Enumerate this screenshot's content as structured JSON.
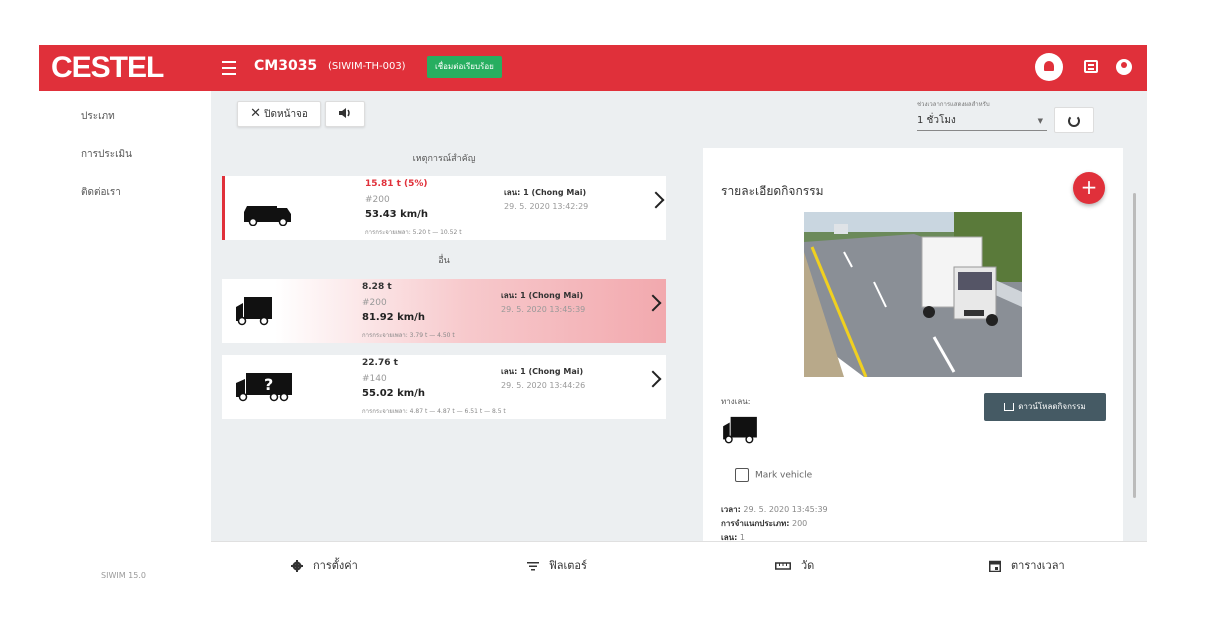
{
  "header": {
    "logo": "CESTEL",
    "device_name": "CM3035",
    "device_id": "(SIWIM-TH-003)",
    "connection_status": "เชื่อมต่อเรียบร้อย",
    "brand_color": "#e0303a",
    "status_color": "#27ae60",
    "icons": [
      "menu-icon",
      "notification-bell-icon",
      "chat-icon",
      "account-icon"
    ]
  },
  "sidebar": {
    "items": [
      {
        "label": "ประเภท"
      },
      {
        "label": "การประเมิน"
      },
      {
        "label": "ติดต่อเรา"
      }
    ],
    "version": "SIWIM 15.0"
  },
  "toolbar": {
    "close_label": "ปิดหน้าจอ",
    "time_range_label": "ช่วงเวลาการแสดงผลสำหรับ",
    "time_range_value": "1 ชั่วโมง"
  },
  "sections": {
    "important": "เหตุการณ์สำคัญ",
    "other": "อื่น"
  },
  "events": [
    {
      "weight": "15.81 t (5%)",
      "class": "#200",
      "speed": "53.43 km/h",
      "axles": "การกระจายเพลา: 5.20 t — 10.52 t",
      "lane": "เลน: 1 (Chong Mai)",
      "time": "29. 5. 2020 13:42:29",
      "icon": "van-icon"
    },
    {
      "weight": "8.28 t",
      "class": "#200",
      "speed": "81.92 km/h",
      "axles": "การกระจายเพลา: 3.79 t — 4.50 t",
      "lane": "เลน: 1 (Chong Mai)",
      "time": "29. 5. 2020 13:45:39",
      "icon": "truck-icon"
    },
    {
      "weight": "22.76 t",
      "class": "#140",
      "speed": "55.02 km/h",
      "axles": "การกระจายเพลา: 4.87 t — 4.87 t — 6.51 t — 8.5 t",
      "lane": "เลน: 1 (Chong Mai)",
      "time": "29. 5. 2020 13:44:26",
      "icon": "unknown-truck-icon"
    }
  ],
  "detail": {
    "title": "รายละเอียดกิจกรรม",
    "vehicle_type_label": "ทางเลน:",
    "download_label": "ดาวน์โหลดกิจกรรม",
    "mark_vehicle": "Mark vehicle",
    "time_label": "เวลา:",
    "time_value": "29. 5. 2020 13:45:39",
    "class_label": "การจำแนกประเภท:",
    "class_value": "200",
    "lane_label": "เลน:",
    "lane_value": "1"
  },
  "bottom_nav": [
    {
      "label": "การตั้งค่า",
      "icon": "gear-icon"
    },
    {
      "label": "ฟิลเตอร์",
      "icon": "filter-icon"
    },
    {
      "label": "วัด",
      "icon": "ruler-icon"
    },
    {
      "label": "ตารางเวลา",
      "icon": "calendar-icon"
    }
  ]
}
